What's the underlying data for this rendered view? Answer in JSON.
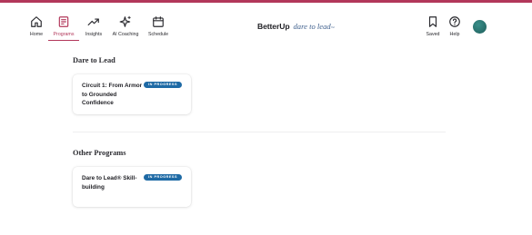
{
  "colors": {
    "accent": "#b2375a",
    "badge": "#1e6aa5",
    "logo_subtitle": "#3d5e8c",
    "avatar": "#2a7a76"
  },
  "nav": {
    "items": [
      {
        "label": "Home",
        "icon": "home-icon",
        "active": false
      },
      {
        "label": "Programs",
        "icon": "programs-icon",
        "active": true
      },
      {
        "label": "Insights",
        "icon": "trending-up-icon",
        "active": false
      },
      {
        "label": "AI Coaching",
        "icon": "sparkle-icon",
        "active": false
      },
      {
        "label": "Schedule",
        "icon": "calendar-icon",
        "active": false
      }
    ],
    "right_items": [
      {
        "label": "Saved",
        "icon": "bookmark-icon"
      },
      {
        "label": "Help",
        "icon": "help-icon"
      }
    ]
  },
  "logo": {
    "brand": "BetterUp",
    "subtitle": "dare to lead",
    "mark": "™"
  },
  "sections": [
    {
      "heading": "Dare to Lead",
      "cards": [
        {
          "title": "Circuit 1: From Armor to Grounded Confidence",
          "badge": "IN PROGRESS"
        }
      ]
    },
    {
      "heading": "Other Programs",
      "cards": [
        {
          "title": "Dare to Lead® Skill-building",
          "badge": "IN PROGRESS"
        }
      ]
    }
  ]
}
